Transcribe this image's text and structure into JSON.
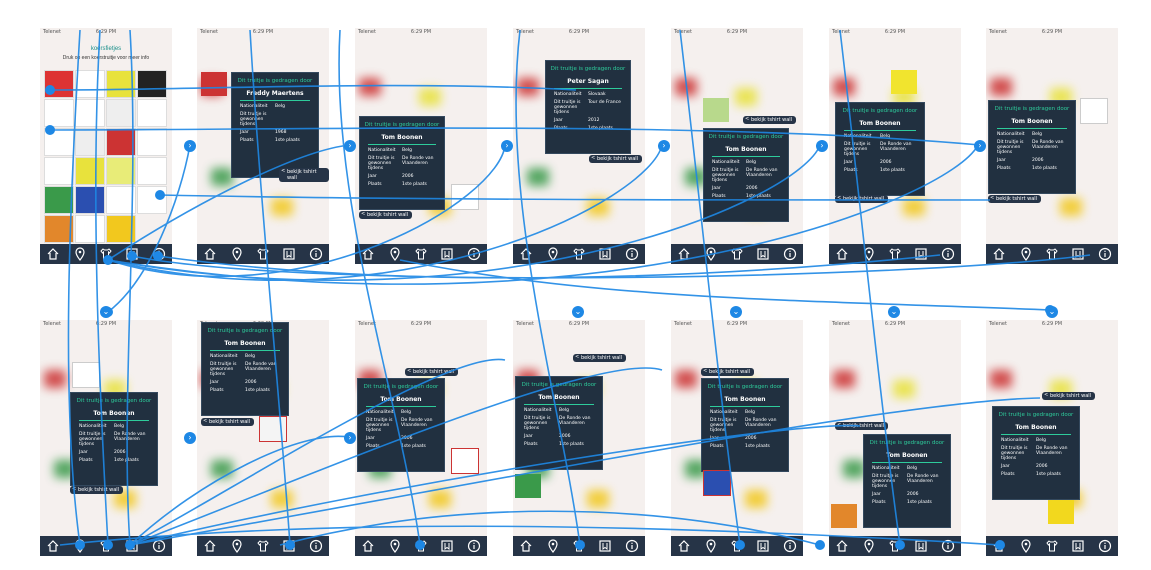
{
  "status": {
    "carrier": "Telenet",
    "time": "6:29 PM"
  },
  "home": {
    "title": "koersfietjes",
    "subtitle": "Druk op een koerstruitje voor meer info"
  },
  "popup": {
    "head": "Dit truitje is gedragen door",
    "labels": {
      "nationality": "Nationaliteit",
      "won": "Dit truitje is gewonnen tijdens",
      "year": "Jaar",
      "place": "Plaats"
    },
    "riders": [
      {
        "name": "Freddy Maertens",
        "nationality": "Belg",
        "race": "",
        "year": "1968",
        "place": "1ste plaats"
      },
      {
        "name": "Tom Boonen",
        "nationality": "Belg",
        "race": "De Ronde van Vlaanderen",
        "year": "2006",
        "place": "1ste plaats"
      },
      {
        "name": "Peter Sagan",
        "nationality": "Slovaak",
        "race": "Tour de France",
        "year": "2012",
        "place": "1ste plaats"
      }
    ]
  },
  "wall_label": "bekijk tshirt wall",
  "icons": [
    "home-icon",
    "map-pin-icon",
    "shirt-icon",
    "bookmark-icon",
    "info-icon"
  ],
  "colors": {
    "wire": "#1e88e5",
    "tabbar": "#263447",
    "accent": "#2ecc9b",
    "popup": "#213040"
  }
}
